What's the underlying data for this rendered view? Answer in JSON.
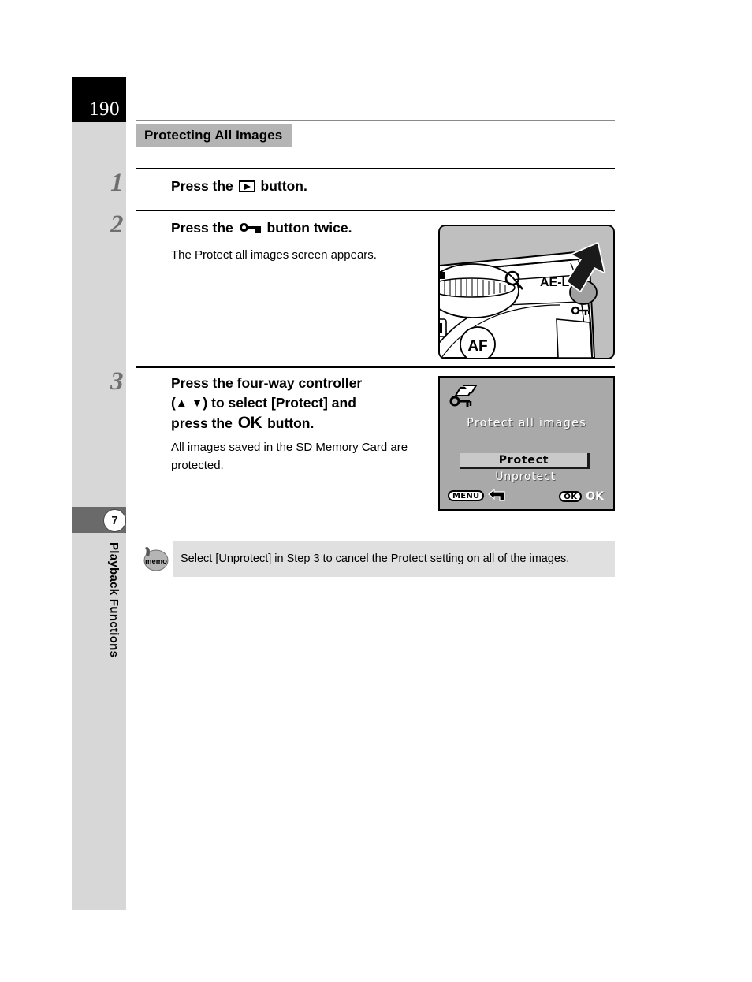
{
  "page": {
    "number": "190",
    "chapter_number": "7",
    "chapter_title": "Playback Functions"
  },
  "section": {
    "heading": "Protecting All Images"
  },
  "steps": [
    {
      "number": "1",
      "title_before": "Press the",
      "icon": "playback-icon",
      "title_after": "button.",
      "body": ""
    },
    {
      "number": "2",
      "title_before": "Press the",
      "icon": "key-icon",
      "title_after": "button twice.",
      "body": "The Protect all images screen appears."
    },
    {
      "number": "3",
      "title_line1": "Press the four-way controller",
      "title_line2_before": "(",
      "title_arrow_up": "▲",
      "title_arrow_down": "▼",
      "title_line2_after": ") to select [Protect] and",
      "title_line3_before": "press the",
      "title_ok": "OK",
      "title_line3_after": "button.",
      "body": "All images saved in the SD Memory Card are protected."
    }
  ],
  "camera_figure": {
    "name": "camera-rear-illustration",
    "label_ae_l": "AE-L",
    "label_af": "AF",
    "magnify_icon": "magnifier-icon",
    "key_icon": "key-icon",
    "arrow_icon": "arrow-pointer-icon"
  },
  "lcd_figure": {
    "name": "protect-all-images-screen",
    "icon": "protect-all-images-icon",
    "title": "Protect all images",
    "options": [
      {
        "label": "Protect",
        "selected": true
      },
      {
        "label": "Unprotect",
        "selected": false
      }
    ],
    "footer": {
      "menu_button": "MENU",
      "back_icon": "back-arrow-icon",
      "ok_button": "OK",
      "ok_label": "OK"
    }
  },
  "memo": {
    "icon_label": "memo",
    "text": "Select [Unprotect] in Step 3 to cancel the Protect setting on all of the images."
  },
  "colors": {
    "sidebar_gray": "#d7d7d7",
    "chapter_band": "#6a6a6a",
    "heading_band": "#b4b4b4",
    "memo_bg": "#e0e0e0",
    "lcd_bg": "#a9a9a9",
    "camera_bg": "#bfbfbf"
  }
}
